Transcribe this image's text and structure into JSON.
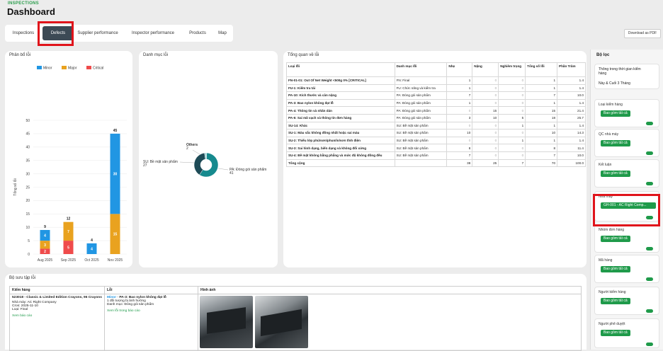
{
  "header": {
    "section": "INSPECTIONS",
    "title": "Dashboard"
  },
  "tabs": [
    "Inspections",
    "Defects",
    "Supplier performance",
    "Inspector performance",
    "Products",
    "Map"
  ],
  "active_tab": "Defects",
  "download_label": "Download as PDF",
  "chart_bar": {
    "card_title": "Phân bổ lỗi",
    "chart_data": {
      "type": "bar",
      "stacked": true,
      "categories": [
        "Aug 2025",
        "Sep 2025",
        "Oct 2025",
        "Nov 2025"
      ],
      "series": [
        {
          "name": "Minor",
          "color": "#2196e3",
          "values": [
            4,
            0,
            4,
            30
          ]
        },
        {
          "name": "Major",
          "color": "#e9a21f",
          "values": [
            3,
            7,
            0,
            15
          ]
        },
        {
          "name": "Critical",
          "color": "#ef4b4b",
          "values": [
            2,
            5,
            0,
            0
          ]
        }
      ],
      "totals": [
        9,
        12,
        4,
        45
      ],
      "ylabel": "Tổng số lỗi",
      "ylim": [
        0,
        50
      ],
      "yticks": [
        0,
        5,
        10,
        15,
        20,
        25,
        30,
        35,
        40,
        45,
        50
      ],
      "legend": "top-left"
    }
  },
  "chart_pie": {
    "card_title": "Danh mục lỗi",
    "chart_data": {
      "type": "pie",
      "donut": true,
      "slices": [
        {
          "label": "PA: Đóng gói sản phẩm",
          "value": 41,
          "color": "#168a8e"
        },
        {
          "label": "SU: Bề mặt sản phẩm",
          "value": 27,
          "color": "#1e4b57"
        },
        {
          "label": "Others",
          "value": 2,
          "color": "#9ad3d6"
        }
      ]
    }
  },
  "summary": {
    "card_title": "Tổng quan về lỗi",
    "headers": [
      "Loại lỗi",
      "Danh mục lỗi",
      "Nhẹ",
      "Nặng",
      "Nghiêm trọng",
      "Tổng số lỗi",
      "Phần Trăm"
    ],
    "rows": [
      [
        "FN-01-01: Out Of Net Weight <500g 0% [CRITICAL]",
        "FN: Final",
        "1",
        "0",
        "0",
        "1",
        "1.4"
      ],
      [
        "FU-1: Kiểm tra tải",
        "FU: Chức năng và kiểm tra",
        "1",
        "0",
        "0",
        "1",
        "1.4"
      ],
      [
        "PA-10: Kích thước và cân nặng",
        "PA: Đóng gói sản phẩm",
        "7",
        "0",
        "0",
        "7",
        "10.0"
      ],
      [
        "PA-3: Bao nylon không đạt lỗ",
        "PA: Đóng gói sản phẩm",
        "1",
        "0",
        "0",
        "1",
        "1.4"
      ],
      [
        "PA-4: Thông tin và nhãn dán",
        "PA: Đóng gói sản phẩm",
        "0",
        "15",
        "0",
        "15",
        "21.4"
      ],
      [
        "PA-6: Sai mã vạch và thông tin đơn hàng",
        "PA: Đóng gói sản phẩm",
        "3",
        "10",
        "5",
        "18",
        "25.7"
      ],
      [
        "SU-14: Khác",
        "SU: Bề mặt sản phẩm",
        "0",
        "0",
        "1",
        "1",
        "1.4"
      ],
      [
        "SU-1: Màu sắc không đồng nhất hoặc sai màu",
        "SU: Bề mặt sản phẩm",
        "10",
        "0",
        "0",
        "10",
        "14.3"
      ],
      [
        "SU-2: Thiếu lớp phủ/sơn/phun/in/sơn tĩnh điện",
        "SU: Bề mặt sản phẩm",
        "0",
        "0",
        "1",
        "1",
        "1.4"
      ],
      [
        "SU-3: Sai hình dạng, biến dạng và không đối xứng",
        "SU: Bề mặt sản phẩm",
        "8",
        "0",
        "0",
        "8",
        "11.4"
      ],
      [
        "SU-4: Bề mặt không bằng phẳng và mức độ không đồng đều",
        "SU: Bề mặt sản phẩm",
        "7",
        "0",
        "0",
        "7",
        "10.0"
      ]
    ],
    "total_row": [
      "Tổng cộng",
      "",
      "38",
      "25",
      "7",
      "70",
      "100.0"
    ]
  },
  "detail": {
    "card_title": "Bộ sưu tập lỗi",
    "headers": [
      "Kiểm hàng",
      "Lỗi",
      "Hình ảnh"
    ],
    "row": {
      "inspection_title": "523018 - Classic & Limited Edition Crayons, 96 Crayons",
      "factory": "Nhà máy: AC Right Company",
      "date": "Cros: 2025-11-10",
      "type": "Loại: Final",
      "view_report": "Xem báo cáo",
      "defect_level": "Minor",
      "defect_name": "PA-3: Bao nylon không đạt lỗ",
      "affected": "1 đối tượng bị ảnh hưởng",
      "category": "Danh mục: Đóng gói sản phẩm",
      "view_defect": "Xem lỗi trong báo cáo"
    }
  },
  "sidebar": {
    "title": "Bộ lọc",
    "period_label": "Thông trong thời gian kiểm hàng",
    "period_value": "Này & Cuối 3 Tháng",
    "include_all": "Bao gồm tất cả",
    "filters": [
      "Loại kiểm hàng",
      "QC nhà máy",
      "Kết luận",
      "Nhà máy",
      "Nhóm đơn hàng",
      "Mã hàng",
      "Người kiểm hàng",
      "Người phê duyệt"
    ],
    "factory_selected": "GH-001 - AC Right Comp..."
  },
  "colors": {
    "accent": "#1f9a4a",
    "highlight": "#e0141b",
    "tab_active": "#3c4a55"
  }
}
